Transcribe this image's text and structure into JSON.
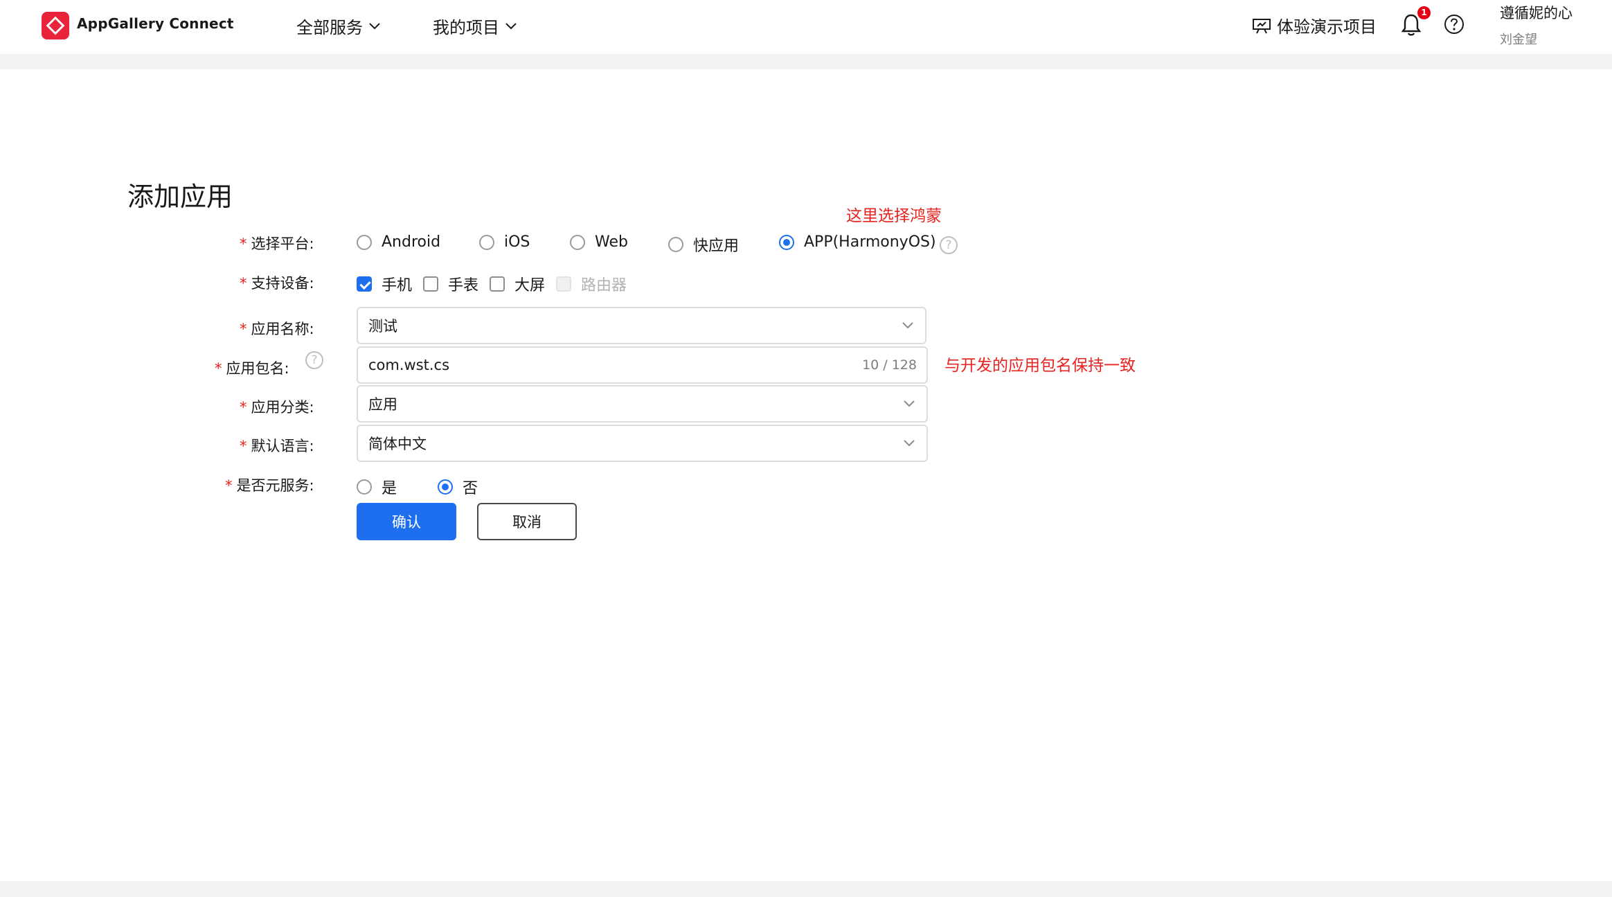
{
  "header": {
    "brand": "AppGallery Connect",
    "nav": [
      {
        "label": "全部服务"
      },
      {
        "label": "我的项目"
      }
    ],
    "demo_label": "体验演示项目",
    "notification_count": "1",
    "user": {
      "name": "遵循妮的心",
      "real_name": "刘金望"
    }
  },
  "page": {
    "title": "添加应用",
    "annotations": {
      "platform_note": "这里选择鸿蒙",
      "package_note": "与开发的应用包名保持一致"
    }
  },
  "form": {
    "required_mark": "*",
    "platform": {
      "label": "选择平台:",
      "options": [
        "Android",
        "iOS",
        "Web",
        "快应用",
        "APP(HarmonyOS)"
      ],
      "selected": "APP(HarmonyOS)"
    },
    "devices": {
      "label": "支持设备:",
      "options": [
        {
          "label": "手机",
          "checked": true,
          "disabled": false
        },
        {
          "label": "手表",
          "checked": false,
          "disabled": false
        },
        {
          "label": "大屏",
          "checked": false,
          "disabled": false
        },
        {
          "label": "路由器",
          "checked": false,
          "disabled": true
        }
      ]
    },
    "app_name": {
      "label": "应用名称:",
      "value": "测试"
    },
    "package_name": {
      "label": "应用包名:",
      "value": "com.wst.cs",
      "counter": "10 / 128"
    },
    "category": {
      "label": "应用分类:",
      "value": "应用"
    },
    "language": {
      "label": "默认语言:",
      "value": "简体中文"
    },
    "meta_service": {
      "label": "是否元服务:",
      "options": [
        "是",
        "否"
      ],
      "selected": "否"
    },
    "confirm_label": "确认",
    "cancel_label": "取消"
  },
  "colors": {
    "primary": "#1e6ff0",
    "annotation": "#e6231f",
    "brand_red": "#e8233a",
    "badge": "#e60012"
  }
}
